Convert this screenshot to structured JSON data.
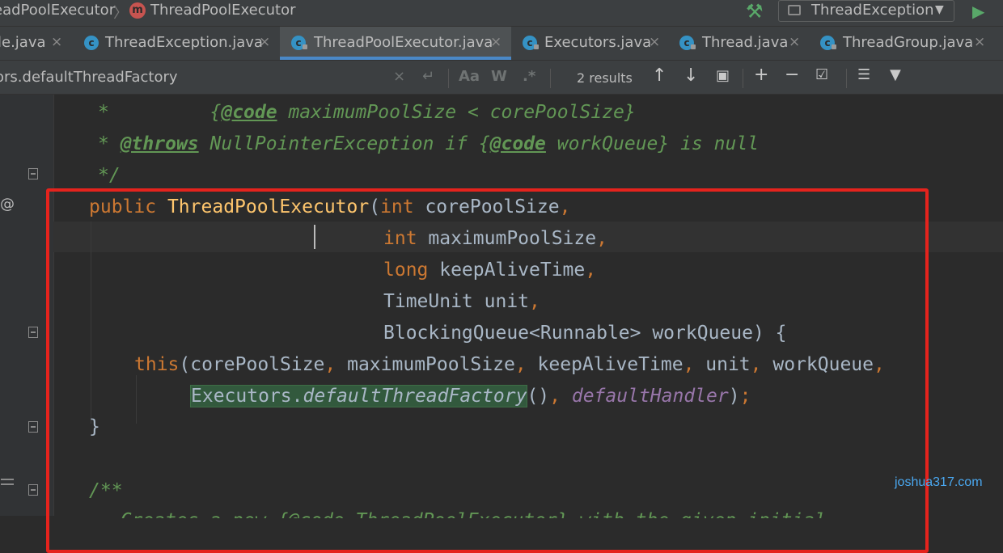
{
  "navbar": {
    "crumb_parent": "eadPoolExecutor",
    "crumb_separator": "〉",
    "class_badge": "m",
    "crumb_current": "ThreadPoolExecutor",
    "run_config": "ThreadException"
  },
  "tabs": [
    {
      "label": "le.java",
      "close": "×"
    },
    {
      "label": "ThreadException.java",
      "close": "×"
    },
    {
      "label": "ThreadPoolExecutor.java",
      "close": "×"
    },
    {
      "label": "Executors.java",
      "close": "×"
    },
    {
      "label": "Thread.java",
      "close": "×"
    },
    {
      "label": "ThreadGroup.java",
      "close": "×"
    }
  ],
  "tab_icon_letter": "c",
  "find": {
    "query": "ors.defaultThreadFactory",
    "results": "2 results",
    "clear": "×",
    "regex_icon": "↵",
    "match_case": "Aa",
    "words": "W",
    "regex": ".*"
  },
  "editor": {
    "line1": {
      "star": "*",
      "tag_open": "{",
      "tag": "@code",
      "text": " maximumPoolSize < corePoolSize}"
    },
    "line2": {
      "star": "* ",
      "tag": "@throws",
      "text1": " NullPointerException if {",
      "tag2": "@code",
      "text2": " workQueue} is null"
    },
    "line3": {
      "end": "*/"
    },
    "line4": {
      "kw": "public",
      "name": "ThreadPoolExecutor",
      "paren": "(",
      "kw2": "int",
      "param": " corePoolSize",
      "comma": ","
    },
    "line5": {
      "kw": "int",
      "param": " maximumPoolSize",
      "comma": ","
    },
    "line6": {
      "kw": "long",
      "param": " keepAliveTime",
      "comma": ","
    },
    "line7": {
      "param": "TimeUnit unit",
      "comma": ","
    },
    "line8": {
      "param": "BlockingQueue<Runnable> workQueue) {"
    },
    "line9": {
      "kw": "this",
      "p1": "(corePoolSize",
      "c1": ",",
      "p2": " maximumPoolSize",
      "c2": ",",
      "p3": " keepAliveTime",
      "c3": ",",
      "p4": " unit",
      "c4": ",",
      "p5": " workQueue",
      "c5": ","
    },
    "line10": {
      "cls": "Executors.",
      "method": "defaultThreadFactory",
      "call": "()",
      "c1": ",",
      "field": "defaultHandler",
      "close": ")",
      "semi": ";"
    },
    "line11": {
      "brace": "}"
    },
    "line12": {
      "start": "/**"
    },
    "line13": {
      "text": "  Creates a new {@code ThreadPoolExecutor} with the given initial"
    }
  },
  "watermark": "joshua317.com",
  "colors": {
    "highlight_border": "#e5231d",
    "tab_underline": "#4a88c7",
    "keyword": "#cc7832",
    "method": "#ffc66d",
    "comment": "#629755",
    "field": "#9876aa"
  }
}
